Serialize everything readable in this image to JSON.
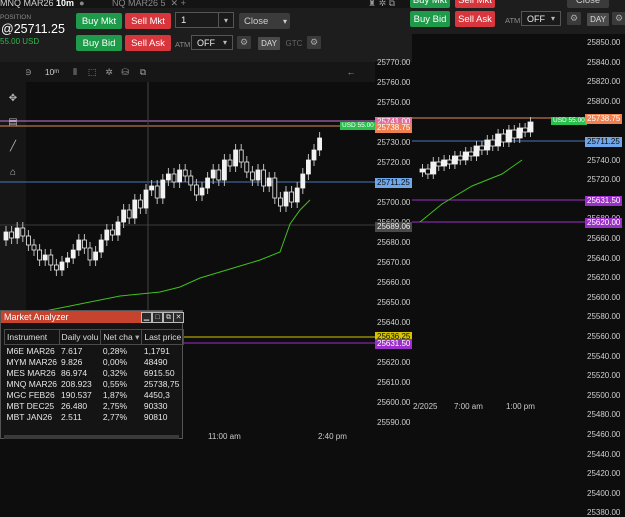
{
  "left_panel": {
    "tabs": [
      {
        "label": "MNQ MAR26",
        "extra": "10",
        "unit": "m",
        "active": true
      },
      {
        "label": "NQ MAR26 5",
        "active": false
      }
    ],
    "position": {
      "label": "POSITION",
      "price": "@25711.25",
      "pnl": "55.00 USD"
    },
    "order": {
      "buy_mkt": "Buy Mkt",
      "sell_mkt": "Sell Mkt",
      "buy_bid": "Buy Bid",
      "sell_ask": "Sell Ask",
      "qty": "1",
      "close": "Close",
      "atm_label": "ATM",
      "atm_value": "OFF",
      "day": "DAY",
      "gtc": "GTC"
    },
    "toolbar_interval": "10ᵐ",
    "y_axis": [
      "25770.00",
      "25760.00",
      "25750.00",
      "25740.00",
      "25730.00",
      "25720.00",
      "25710.00",
      "25700.00",
      "25690.00",
      "25680.00",
      "25670.00",
      "25660.00",
      "25650.00",
      "25640.00",
      "25630.00",
      "25620.00",
      "25610.00",
      "25600.00",
      "25590.00"
    ],
    "x_axis": [
      "11:00 am",
      "2:40 pm"
    ],
    "price_labels": {
      "pnl_tag": "USD 55.00",
      "top_pink": "25741.00",
      "orange": "25738.75",
      "blue": "25711.25",
      "gray": "25689.06",
      "yellow": "25636.25",
      "purple": "25631.50"
    }
  },
  "market_analyzer": {
    "title": "Market Analyzer",
    "columns": [
      "Instrument",
      "Daily volu",
      "Net cha",
      "Last price"
    ],
    "rows": [
      {
        "instrument": "M6E MAR26",
        "volume": "7.617",
        "net_change": "0,28%",
        "last": "1,1791",
        "dir": "pos"
      },
      {
        "instrument": "MYM MAR26",
        "volume": "9.826",
        "net_change": "0,00%",
        "last": "48490",
        "dir": "neg"
      },
      {
        "instrument": "MES MAR26",
        "volume": "86.974",
        "net_change": "0,32%",
        "last": "6915.50",
        "dir": "pos"
      },
      {
        "instrument": "MNQ MAR26",
        "volume": "208.923",
        "net_change": "0,55%",
        "last": "25738,75",
        "dir": "pos"
      },
      {
        "instrument": "MGC FEB26",
        "volume": "190.537",
        "net_change": "1,87%",
        "last": "4450,3",
        "dir": "pos"
      },
      {
        "instrument": "MBT DEC25",
        "volume": "26.480",
        "net_change": "2,75%",
        "last": "90330",
        "dir": "pos"
      },
      {
        "instrument": "MBT JAN26",
        "volume": "2.511",
        "net_change": "2,77%",
        "last": "90810",
        "dir": "pos"
      }
    ]
  },
  "right_panel": {
    "order": {
      "buy_mkt": "Buy Mkt",
      "sell_mkt": "Sell Mkt",
      "buy_bid": "Buy Bid",
      "sell_ask": "Sell Ask",
      "close": "Close",
      "atm_label": "ATM",
      "atm_value": "OFF",
      "day": "DAY"
    },
    "y_axis": [
      "25850.00",
      "25840.00",
      "25820.00",
      "25800.00",
      "25780.00",
      "25760.00",
      "25740.00",
      "25720.00",
      "25700.00",
      "25680.00",
      "25660.00",
      "25640.00",
      "25620.00",
      "25600.00",
      "25580.00",
      "25560.00",
      "25540.00",
      "25520.00",
      "25500.00",
      "25480.00",
      "25460.00",
      "25440.00",
      "25420.00",
      "25400.00",
      "25380.00"
    ],
    "x_axis": [
      "2/2025",
      "7:00 am",
      "1:00 pm"
    ],
    "price_labels": {
      "pnl_tag": "USD 55.00",
      "orange": "25738.75",
      "blue": "25711.25",
      "purple1": "25631.50",
      "purple2": "25620.00"
    }
  }
}
